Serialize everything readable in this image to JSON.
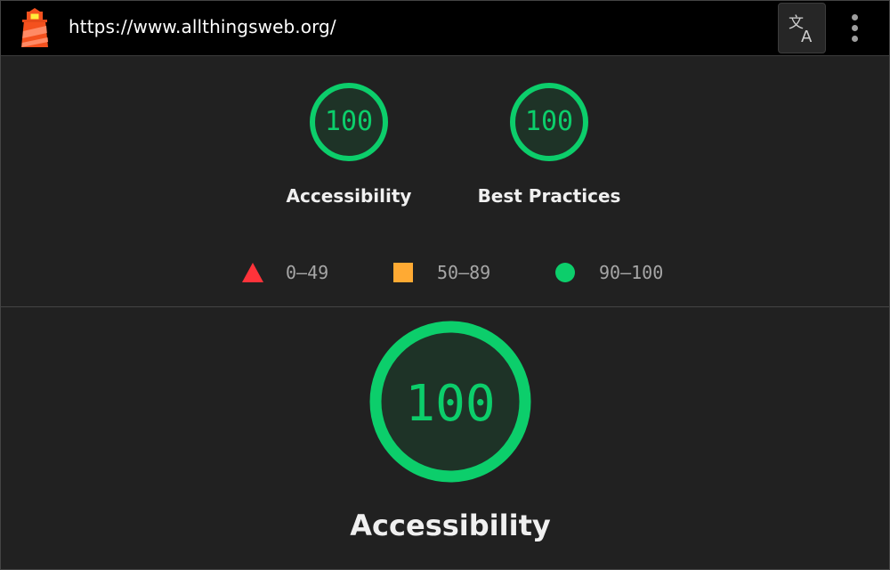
{
  "header": {
    "url": "https://www.allthingsweb.org/",
    "logo_icon": "lighthouse-icon",
    "translate_icon": "translate-icon",
    "menu_icon": "more-vert-icon"
  },
  "summary_gauges": [
    {
      "label": "Accessibility",
      "score": "100"
    },
    {
      "label": "Best Practices",
      "score": "100"
    }
  ],
  "legend": {
    "fail": "0–49",
    "average": "50–89",
    "pass": "90–100"
  },
  "category": {
    "label": "Accessibility",
    "score": "100"
  },
  "colors": {
    "pass": "#0cce6b",
    "average": "#ffaa33",
    "fail": "#ff333a",
    "background": "#212121",
    "topbar": "#000000"
  }
}
